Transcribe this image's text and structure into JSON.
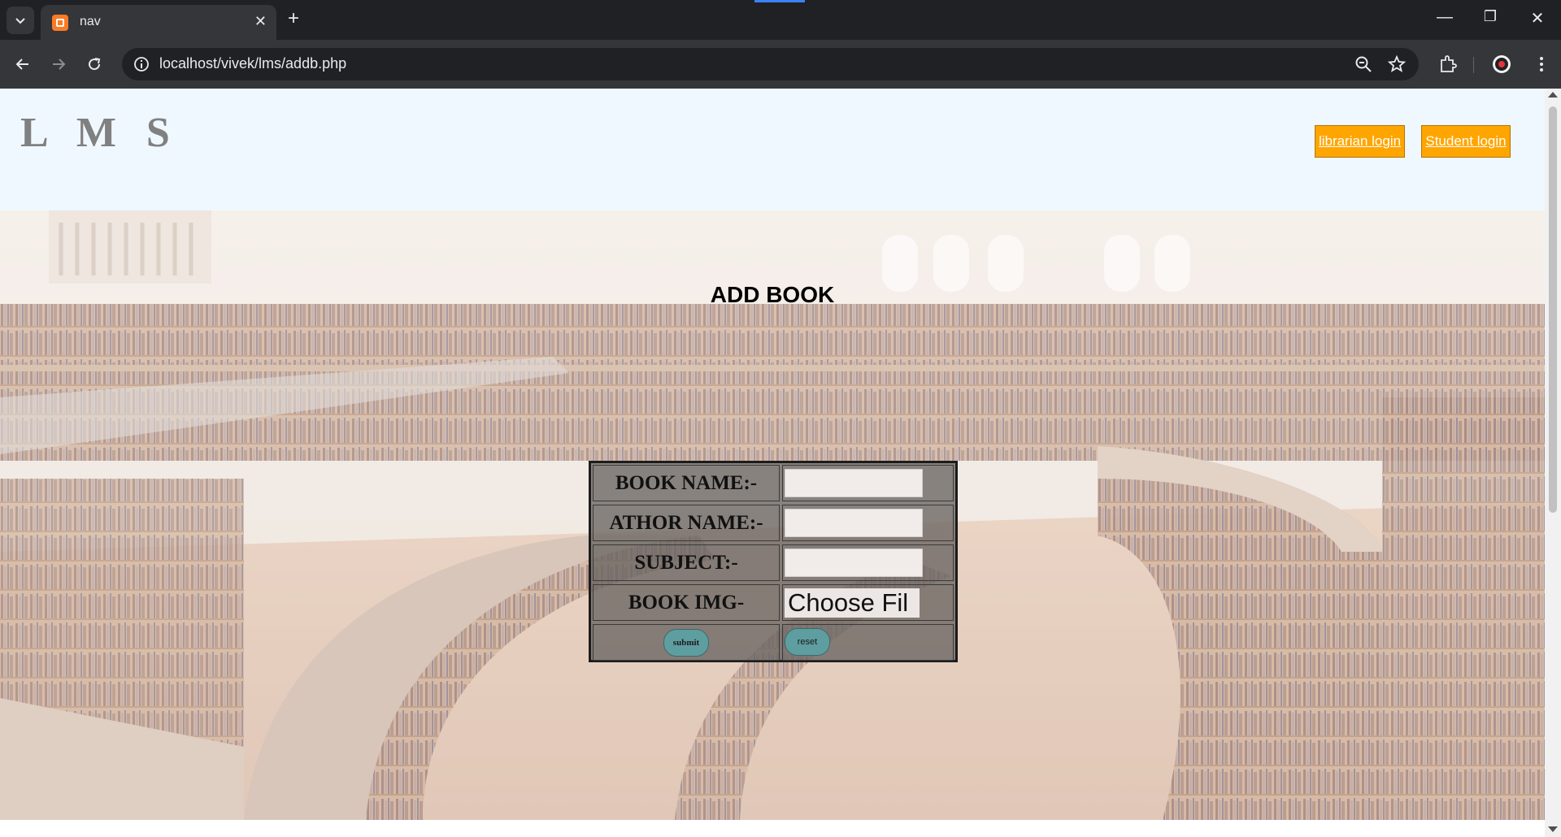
{
  "browser": {
    "tab_title": "nav",
    "url": "localhost/vivek/lms/addb.php",
    "icons": [
      "tab-list-icon",
      "close-icon",
      "plus-icon",
      "back-icon",
      "forward-icon",
      "reload-icon",
      "info-icon",
      "zoom-out-icon",
      "star-icon",
      "extensions-icon",
      "profile-icon",
      "menu-icon",
      "minimize-icon",
      "restore-icon",
      "close-window-icon"
    ]
  },
  "header": {
    "logo": "L M S",
    "links": [
      "librarian login",
      "Student login"
    ]
  },
  "form": {
    "heading": "ADD BOOK",
    "labels": [
      "BOOK NAME:-",
      "ATHOR NAME:-",
      "SUBJECT:-",
      "BOOK IMG-"
    ],
    "file_button": "Choose Fil",
    "submit": "submit",
    "reset": "reset"
  },
  "colors": {
    "header_bg": "#f0f8ff",
    "link_bg": "#ffa500",
    "button_bg": "#5f9ea0"
  }
}
